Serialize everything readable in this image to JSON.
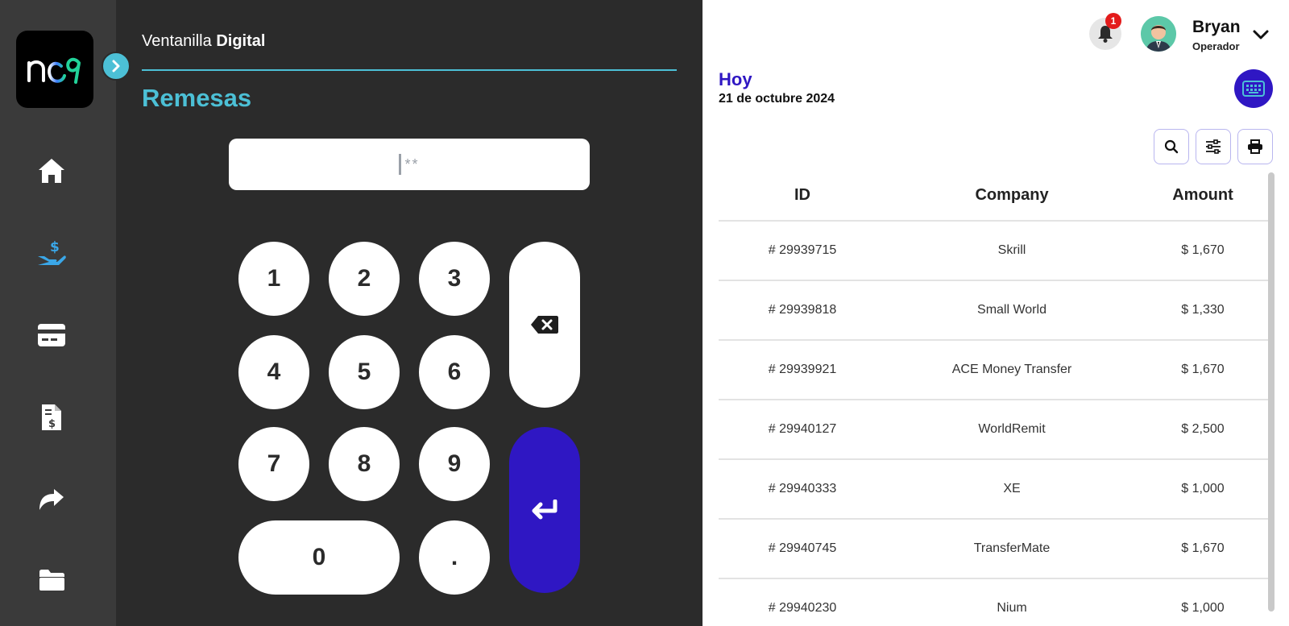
{
  "app": {
    "title_light": "Ventanilla",
    "title_bold": "Digital",
    "section": "Remesas"
  },
  "sidebar": {
    "items": [
      {
        "icon": "home-icon",
        "active": false
      },
      {
        "icon": "hand-dollar-icon",
        "active": true
      },
      {
        "icon": "credit-card-icon",
        "active": false
      },
      {
        "icon": "invoice-icon",
        "active": false
      },
      {
        "icon": "share-icon",
        "active": false
      },
      {
        "icon": "folder-icon",
        "active": false
      }
    ]
  },
  "pin": {
    "masked_value": "**"
  },
  "keypad": {
    "keys": [
      "1",
      "2",
      "3",
      "4",
      "5",
      "6",
      "7",
      "8",
      "9",
      "0",
      "."
    ]
  },
  "header": {
    "notification_count": "1",
    "user_name": "Bryan",
    "user_role": "Operador"
  },
  "summary": {
    "period": "Hoy",
    "date": "21 de octubre 2024"
  },
  "table": {
    "headers": [
      "ID",
      "Company",
      "Amount"
    ],
    "rows": [
      {
        "id": "# 29939715",
        "company": "Skrill",
        "amount": "$ 1,670"
      },
      {
        "id": "# 29939818",
        "company": "Small World",
        "amount": "$ 1,330"
      },
      {
        "id": "# 29939921",
        "company": "ACE Money Transfer",
        "amount": "$ 1,670"
      },
      {
        "id": "# 29940127",
        "company": "WorldRemit",
        "amount": "$ 2,500"
      },
      {
        "id": "# 29940333",
        "company": "XE",
        "amount": "$ 1,000"
      },
      {
        "id": "# 29940745",
        "company": "TransferMate",
        "amount": "$ 1,670"
      },
      {
        "id": "# 29940230",
        "company": "Nium",
        "amount": "$ 1,000"
      }
    ]
  },
  "colors": {
    "accent_cyan": "#4cc0d6",
    "accent_indigo": "#2f17c3",
    "sidebar_bg": "#3a3a3a",
    "panel_bg": "#2b2b2b"
  }
}
